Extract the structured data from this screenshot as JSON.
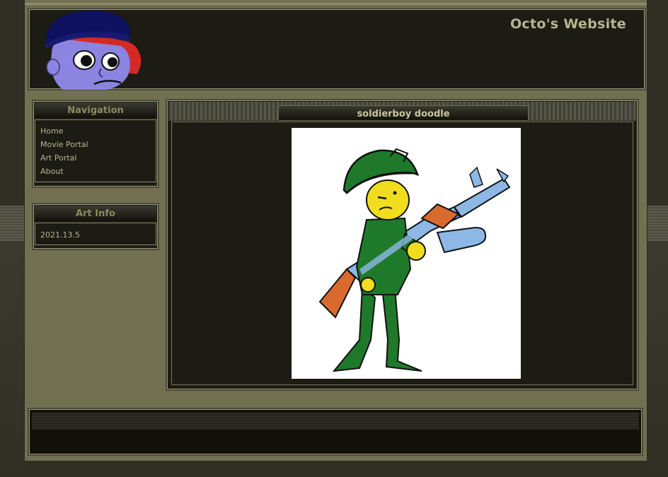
{
  "header": {
    "site_title": "Octo's Website"
  },
  "navigation": {
    "title": "Navigation",
    "links": [
      {
        "label": "Home"
      },
      {
        "label": "Movie Portal"
      },
      {
        "label": "Art Portal"
      },
      {
        "label": "About"
      }
    ]
  },
  "art_info": {
    "title": "Art Info",
    "date": "2021.13.5"
  },
  "artwork": {
    "title": "soldierboy doodle"
  },
  "colors": {
    "frame": "#717050",
    "panel_bg": "#1c1c14",
    "text": "#b8b48f",
    "heading": "#8c8a62"
  },
  "icons": [
    "avatar-octo-icon",
    "soldierboy-doodle-image"
  ]
}
